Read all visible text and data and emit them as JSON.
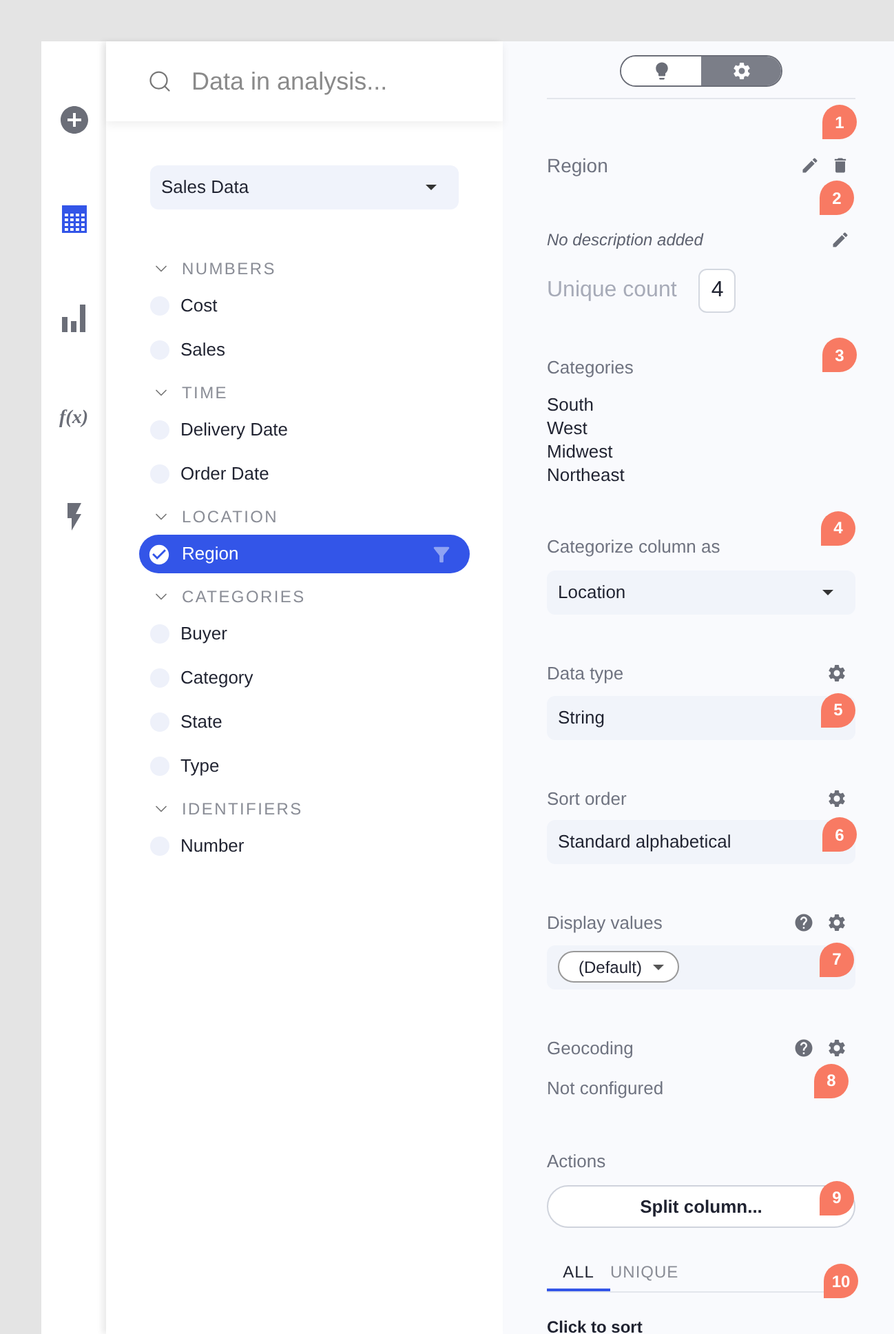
{
  "rail": [
    {
      "kind": "add",
      "selected": false
    },
    {
      "kind": "table",
      "selected": true
    },
    {
      "kind": "chart",
      "selected": false
    },
    {
      "kind": "formula",
      "label": "f(x)",
      "selected": false
    },
    {
      "kind": "action",
      "selected": false
    }
  ],
  "search": {
    "placeholder": "Data in analysis..."
  },
  "dataset": {
    "value": "Sales Data"
  },
  "column_groups": [
    {
      "title": "NUMBERS",
      "expanded": true,
      "columns": [
        {
          "name": "Cost",
          "selected": false
        },
        {
          "name": "Sales",
          "selected": false
        }
      ]
    },
    {
      "title": "TIME",
      "expanded": true,
      "columns": [
        {
          "name": "Delivery Date",
          "selected": false
        },
        {
          "name": "Order Date",
          "selected": false
        }
      ]
    },
    {
      "title": "LOCATION",
      "expanded": true,
      "columns": [
        {
          "name": "Region",
          "selected": true
        }
      ]
    },
    {
      "title": "CATEGORIES",
      "expanded": true,
      "columns": [
        {
          "name": "Buyer",
          "selected": false
        },
        {
          "name": "Category",
          "selected": false
        },
        {
          "name": "State",
          "selected": false
        },
        {
          "name": "Type",
          "selected": false
        }
      ]
    },
    {
      "title": "IDENTIFIERS",
      "expanded": true,
      "columns": [
        {
          "name": "Number",
          "selected": false
        }
      ]
    }
  ],
  "details": {
    "mode_toggle": [
      {
        "kind": "insights",
        "selected": false
      },
      {
        "kind": "settings",
        "selected": true
      }
    ],
    "name": {
      "value": "Region",
      "marker": "1"
    },
    "description": {
      "value": "No description added",
      "marker": "2"
    },
    "unique_count": {
      "label": "Unique count",
      "value": "4"
    },
    "categories": {
      "label": "Categories",
      "values": [
        "South",
        "West",
        "Midwest",
        "Northeast"
      ],
      "marker": "3"
    },
    "categorize": {
      "label": "Categorize column as",
      "value": "Location",
      "marker": "4"
    },
    "data_type": {
      "label": "Data type",
      "value": "String",
      "marker": "5"
    },
    "sort_order": {
      "label": "Sort order",
      "value": "Standard alphabetical",
      "marker": "6"
    },
    "display_values": {
      "label": "Display values",
      "value": "(Default)",
      "marker": "7"
    },
    "geocoding": {
      "label": "Geocoding",
      "value": "Not configured",
      "marker": "8"
    },
    "actions": {
      "label": "Actions",
      "button": "Split column...",
      "marker": "9"
    },
    "tabs": [
      {
        "label": "ALL",
        "selected": true
      },
      {
        "label": "UNIQUE",
        "selected": false
      }
    ],
    "tabs_marker": "10",
    "table_header": "Click to sort"
  }
}
